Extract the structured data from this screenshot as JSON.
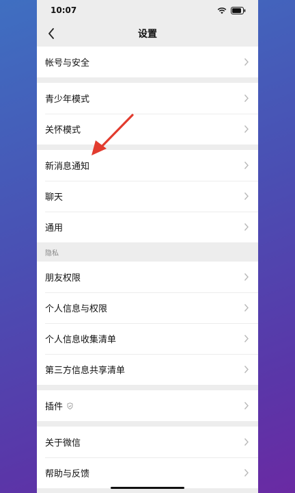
{
  "status_bar": {
    "time": "10:07",
    "icons": [
      "wifi-icon",
      "battery-icon"
    ]
  },
  "nav": {
    "back_icon": "chevron-left-icon",
    "title": "设置"
  },
  "groups": [
    {
      "items": [
        {
          "id": "account-security",
          "label": "帐号与安全"
        }
      ]
    },
    {
      "items": [
        {
          "id": "teen-mode",
          "label": "青少年模式"
        },
        {
          "id": "care-mode",
          "label": "关怀模式"
        }
      ]
    },
    {
      "items": [
        {
          "id": "new-message-notifications",
          "label": "新消息通知"
        },
        {
          "id": "chat",
          "label": "聊天"
        },
        {
          "id": "general",
          "label": "通用"
        }
      ]
    },
    {
      "header": "隐私",
      "items": [
        {
          "id": "friend-permissions",
          "label": "朋友权限"
        },
        {
          "id": "personal-info-permissions",
          "label": "个人信息与权限"
        },
        {
          "id": "personal-info-collection-list",
          "label": "个人信息收集清单"
        },
        {
          "id": "third-party-sharing-list",
          "label": "第三方信息共享清单"
        }
      ]
    },
    {
      "items": [
        {
          "id": "plugins",
          "label": "插件",
          "badge_icon": "shield-icon"
        }
      ]
    },
    {
      "items": [
        {
          "id": "about-wechat",
          "label": "关于微信"
        },
        {
          "id": "help-feedback",
          "label": "帮助与反馈"
        }
      ]
    }
  ],
  "annotation": {
    "arrow_color": "#e23b2e",
    "target": "new-message-notifications"
  }
}
